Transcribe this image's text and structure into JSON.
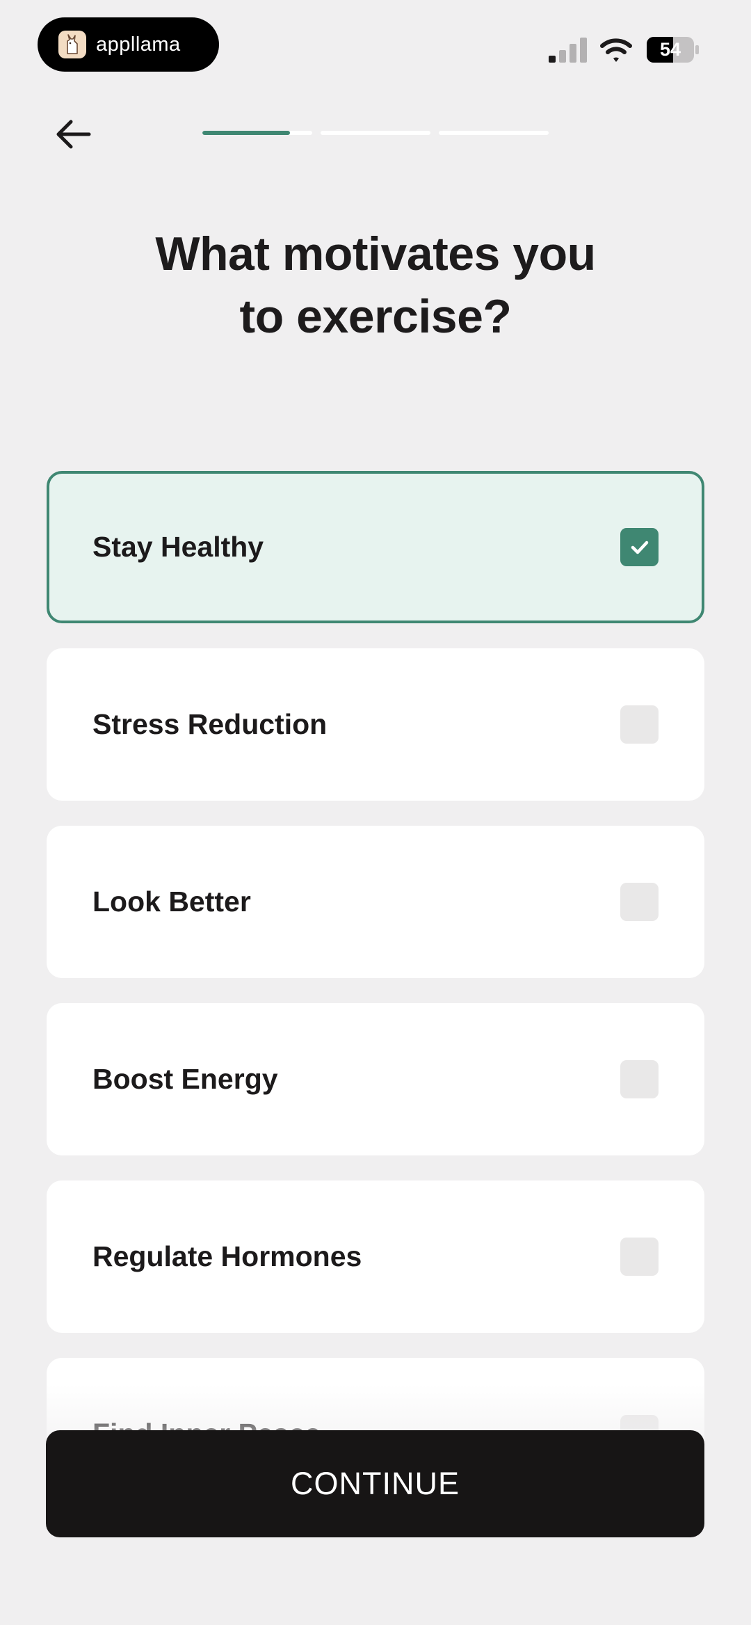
{
  "status_bar": {
    "app_name": "appllama",
    "logo_icon": "llama-icon",
    "battery": "54",
    "signal_icon": "cellular-signal-icon",
    "wifi_icon": "wifi-icon"
  },
  "header": {
    "back_icon": "arrow-left-icon",
    "progress_segments": [
      {
        "fill_fraction": 0.8
      },
      {
        "fill_fraction": 0.0
      },
      {
        "fill_fraction": 0.0
      }
    ]
  },
  "question": {
    "line1": "What motivates you",
    "line2": "to exercise?"
  },
  "options": [
    {
      "label": "Stay Healthy",
      "checked": true
    },
    {
      "label": "Stress Reduction",
      "checked": false
    },
    {
      "label": "Look Better",
      "checked": false
    },
    {
      "label": "Boost Energy",
      "checked": false
    },
    {
      "label": "Regulate Hormones",
      "checked": false
    },
    {
      "label": "Find Inner Peace",
      "checked": false
    }
  ],
  "continue_label": "CONTINUE",
  "colors": {
    "accent": "#3f8772",
    "selected_bg": "#e7f3ef",
    "background": "#f0eff0",
    "button": "#171515"
  }
}
